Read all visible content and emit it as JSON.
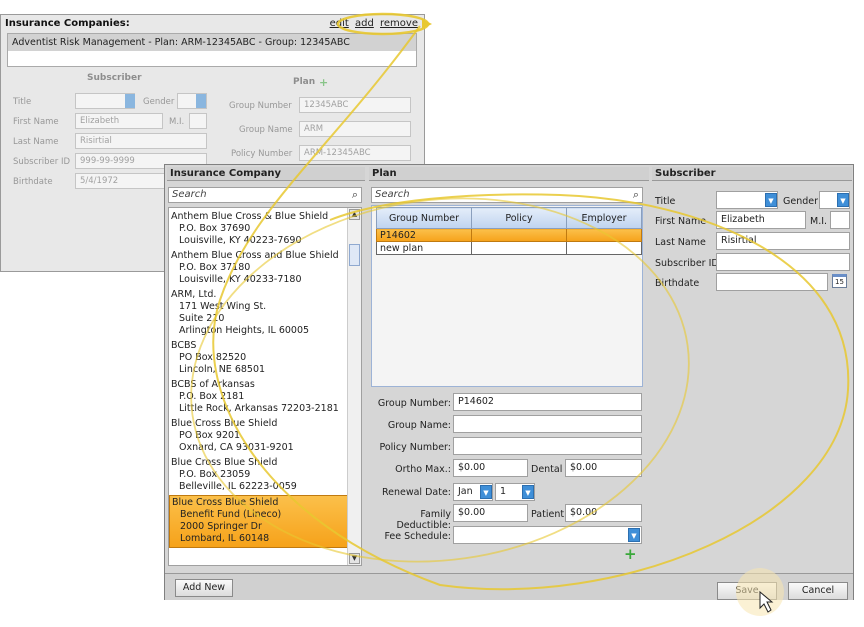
{
  "background_window": {
    "insurance_title": "Insurance Companies:",
    "links": {
      "edit": "edit",
      "add": "add",
      "remove": "remove"
    },
    "selected_plan_row": "Adventist Risk Management - Plan: ARM-12345ABC - Group: 12345ABC",
    "subscriber": {
      "heading": "Subscriber",
      "title_label": "Title",
      "gender_label": "Gender",
      "first_name_label": "First Name",
      "first_name_value": "Elizabeth",
      "mi_label": "M.I.",
      "last_name_label": "Last Name",
      "last_name_value": "Risirtial",
      "subscriber_id_label": "Subscriber ID",
      "subscriber_id_value": "999-99-9999",
      "birthdate_label": "Birthdate",
      "birthdate_value": "5/4/1972"
    },
    "plan": {
      "heading": "Plan",
      "group_number_label": "Group Number",
      "group_number_value": "12345ABC",
      "group_name_label": "Group Name",
      "group_name_value": "ARM",
      "policy_number_label": "Policy Number",
      "policy_number_value": "ARM-12345ABC"
    }
  },
  "dialog": {
    "insurance_company": {
      "heading": "Insurance Company",
      "search_placeholder": "Search",
      "companies": [
        {
          "name": "Anthem Blue Cross & Blue Shield",
          "lines": [
            "P.O. Box 37690",
            "Louisville, KY 40223-7690"
          ]
        },
        {
          "name": "Anthem Blue Cross and Blue Shield",
          "lines": [
            "P.O. Box 37180",
            "Louisville, KY 40233-7180"
          ]
        },
        {
          "name": "ARM, Ltd.",
          "lines": [
            "171 West Wing St.",
            "Suite 210",
            "Arlington Heights, IL 60005"
          ]
        },
        {
          "name": "BCBS",
          "lines": [
            "PO Box 82520",
            "Lincoln, NE 68501"
          ]
        },
        {
          "name": "BCBS of Arkansas",
          "lines": [
            "P.O. Box 2181",
            "Little Rock, Arkansas 72203-2181"
          ]
        },
        {
          "name": "Blue Cross Blue Shield",
          "lines": [
            "PO Box 9201",
            "Oxnard, CA 93031-9201"
          ]
        },
        {
          "name": "Blue Cross Blue Shield",
          "lines": [
            "P.O. Box 23059",
            "Belleville, IL 62223-0059"
          ]
        },
        {
          "name": "Blue Cross Blue Shield",
          "lines": [
            "Benefit Fund (Lineco)",
            "2000 Springer Dr",
            "Lombard, IL 60148"
          ],
          "selected": true
        }
      ],
      "add_new_label": "Add New"
    },
    "plan": {
      "heading": "Plan",
      "search_placeholder": "Search",
      "columns": [
        "Group Number",
        "Policy",
        "Employer"
      ],
      "rows": [
        {
          "cells": [
            "P14602",
            "",
            ""
          ],
          "selected": true
        },
        {
          "cells": [
            "new plan",
            "",
            ""
          ],
          "selected": false
        }
      ],
      "group_number_label": "Group Number:",
      "group_number_value": "P14602",
      "group_name_label": "Group Name:",
      "group_name_value": "",
      "policy_number_label": "Policy Number:",
      "policy_number_value": "",
      "ortho_max_label": "Ortho Max.:",
      "ortho_max_value": "$0.00",
      "dental_label": "Dental",
      "dental_value": "$0.00",
      "renewal_date_label": "Renewal Date:",
      "renewal_month": "Jan",
      "renewal_day": "1",
      "family_deductible_label": "Family Deductible:",
      "family_deductible_value": "$0.00",
      "patient_label": "Patient",
      "patient_value": "$0.00",
      "fee_schedule_label": "Fee Schedule:",
      "fee_schedule_value": ""
    },
    "subscriber": {
      "heading": "Subscriber",
      "title_label": "Title",
      "title_value": "",
      "gender_label": "Gender",
      "gender_value": "",
      "first_name_label": "First Name",
      "first_name_value": "Elizabeth",
      "mi_label": "M.I.",
      "mi_value": "",
      "last_name_label": "Last Name",
      "last_name_value": "Risirtial",
      "subscriber_id_label": "Subscriber ID.",
      "subscriber_id_value": "",
      "birthdate_label": "Birthdate",
      "birthdate_value": "",
      "calendar_day": "15"
    },
    "buttons": {
      "save": "Save",
      "cancel": "Cancel"
    }
  },
  "colors": {
    "highlight_orange": "#f6a21a",
    "annotation_yellow": "#e8c830",
    "dropdown_blue": "#3f8fd8",
    "add_green": "#3aa83a"
  }
}
